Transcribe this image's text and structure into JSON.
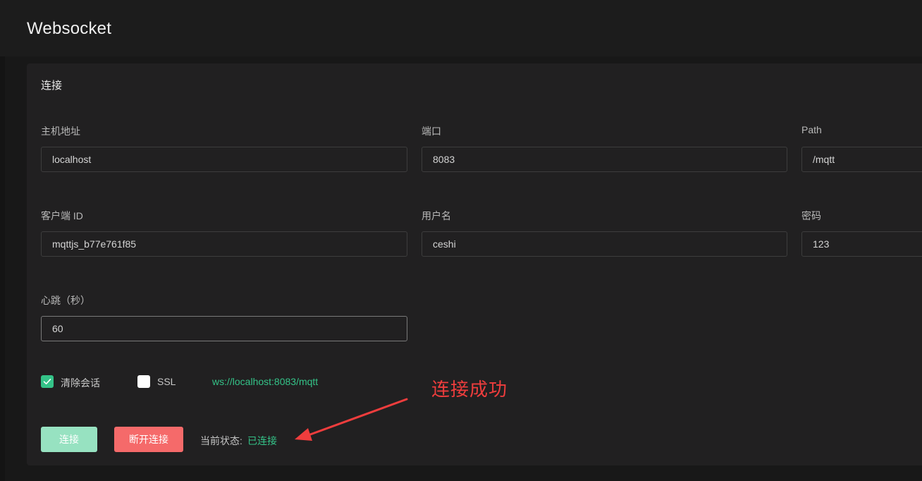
{
  "page": {
    "title": "Websocket"
  },
  "card": {
    "title": "连接"
  },
  "fields": {
    "host": {
      "label": "主机地址",
      "value": "localhost"
    },
    "port": {
      "label": "端口",
      "value": "8083"
    },
    "path": {
      "label": "Path",
      "value": "/mqtt"
    },
    "client_id": {
      "label": "客户端 ID",
      "value": "mqttjs_b77e761f85"
    },
    "username": {
      "label": "用户名",
      "value": "ceshi"
    },
    "password": {
      "label": "密码",
      "value": "123"
    },
    "keepalive": {
      "label": "心跳（秒）",
      "value": "60"
    }
  },
  "options": {
    "clean_session": {
      "label": "清除会话",
      "checked": true
    },
    "ssl": {
      "label": "SSL",
      "checked": false
    },
    "ws_url": "ws://localhost:8083/mqtt"
  },
  "actions": {
    "connect_label": "连接",
    "disconnect_label": "断开连接"
  },
  "status": {
    "label": "当前状态:",
    "value": "已连接"
  },
  "annotation": {
    "text": "连接成功",
    "color": "#ef3d3d"
  },
  "colors": {
    "accent_green": "#34c388",
    "danger_red": "#f56a6a",
    "connect_disabled": "#97e2c1"
  },
  "icons": {
    "checkbox_checked": "check-icon",
    "annotation_arrow": "arrow-icon"
  }
}
